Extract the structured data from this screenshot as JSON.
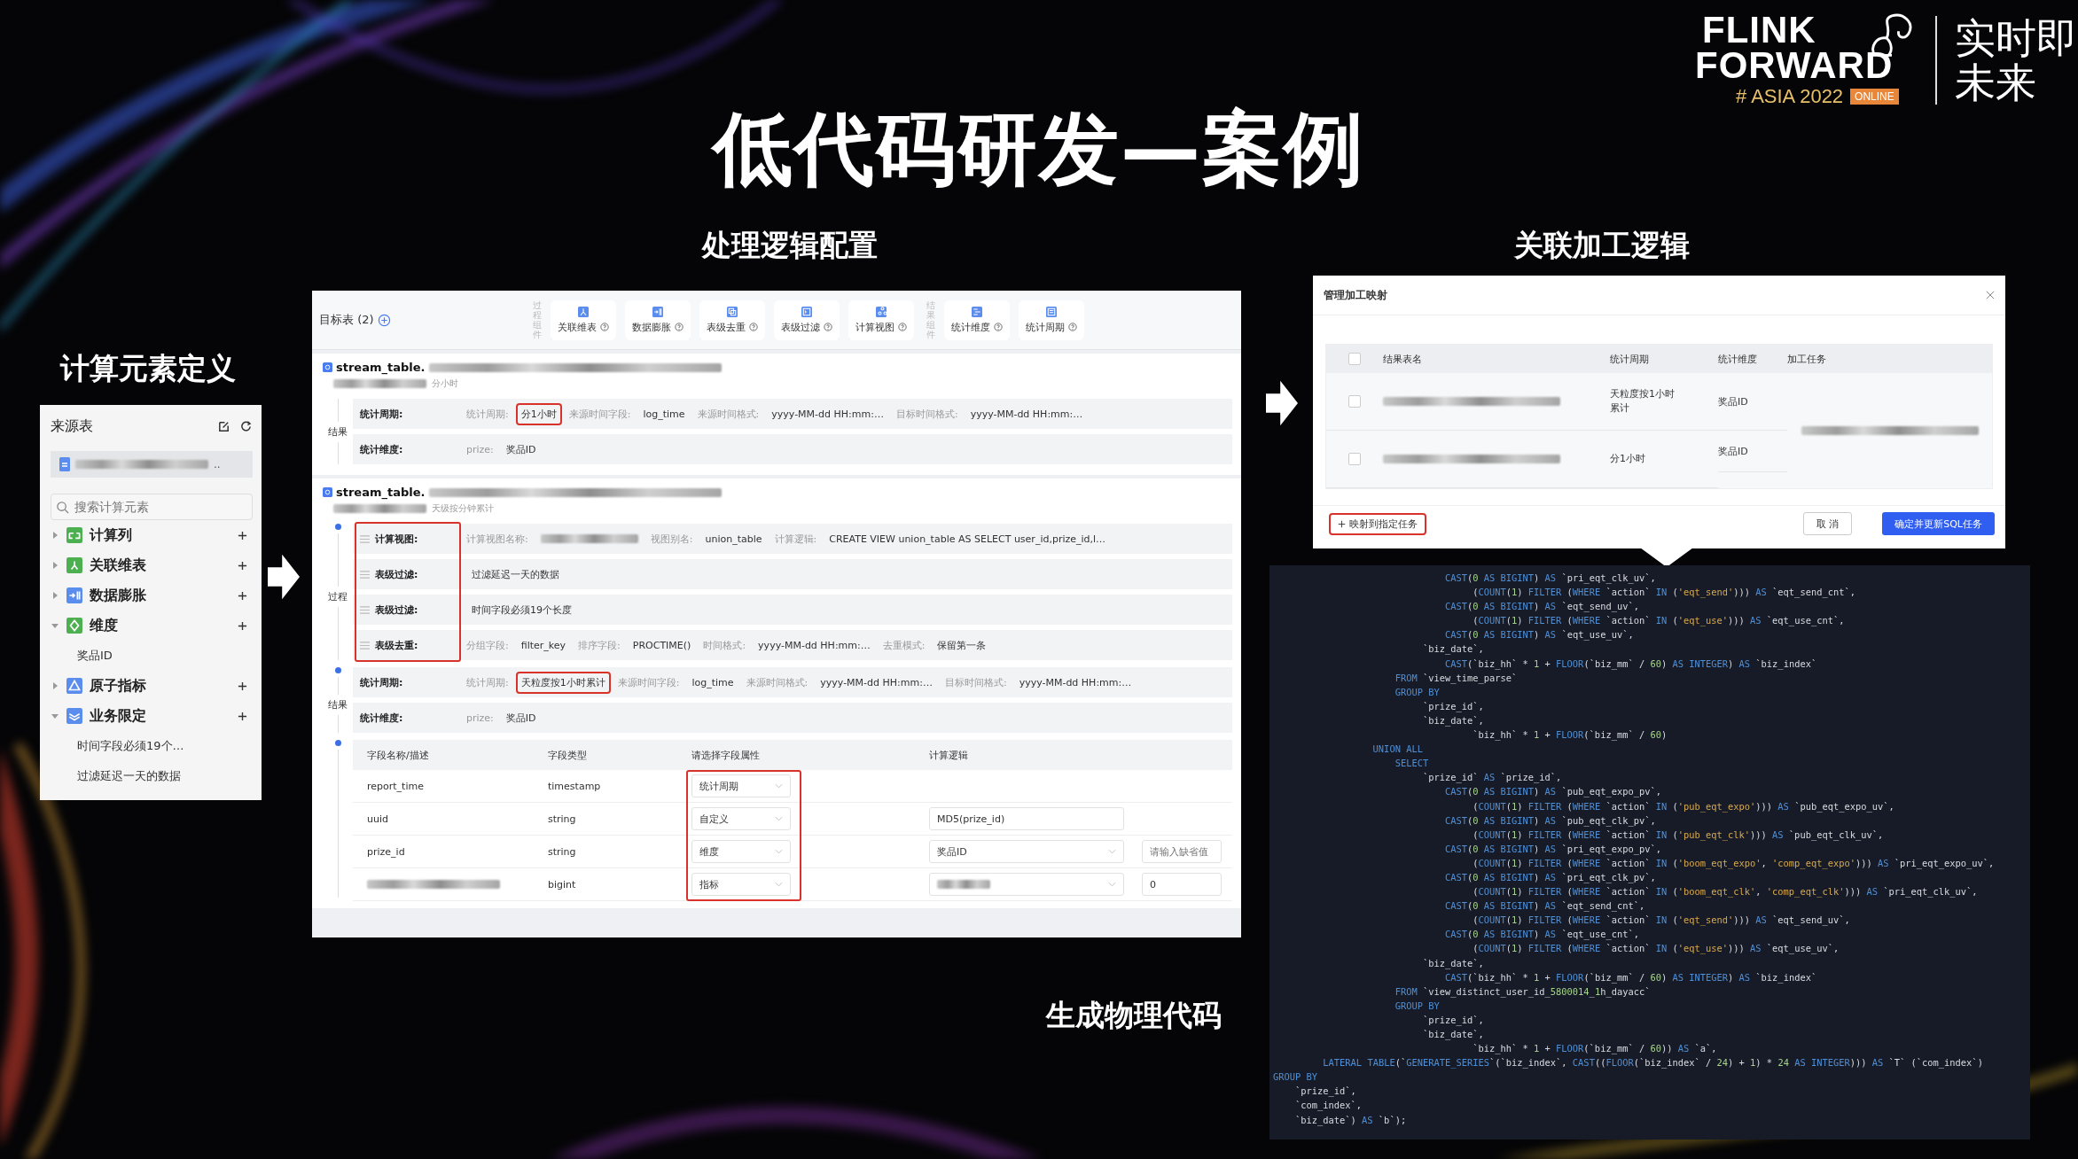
{
  "title": "低代码研发—案例",
  "logo": {
    "name_lines": [
      "FLINK",
      "FORWARD"
    ],
    "event": "# ASIA 2022",
    "badge": "ONLINE",
    "slogan_lines": [
      "实时即",
      "未来"
    ]
  },
  "element_panel": {
    "heading": "计算元素定义",
    "title": "来源表",
    "source": {
      "suffix": ".."
    },
    "search": {
      "placeholder": "搜索计算元素"
    },
    "tree": [
      {
        "label": "计算列",
        "kind": "calc",
        "color": "#4cb050",
        "expanded": false
      },
      {
        "label": "关联维表",
        "kind": "join",
        "color": "#4cb050",
        "expanded": false
      },
      {
        "label": "数据膨胀",
        "kind": "expand",
        "color": "#5b8def",
        "expanded": false
      },
      {
        "label": "维度",
        "kind": "dimension",
        "color": "#4cb050",
        "expanded": true,
        "children": [
          {
            "label": "奖品ID"
          }
        ]
      },
      {
        "label": "原子指标",
        "kind": "metric",
        "color": "#5b8def",
        "expanded": false
      },
      {
        "label": "业务限定",
        "kind": "filter",
        "color": "#5b8def",
        "expanded": true,
        "children": [
          {
            "label": "时间字段必须19个…"
          },
          {
            "label": "过滤延迟一天的数据"
          }
        ]
      }
    ]
  },
  "logic_panel": {
    "heading": "处理逻辑配置",
    "toolbar": {
      "target_label": "目标表 (2)",
      "groups": [
        {
          "label": "过程组件",
          "buttons": [
            {
              "label": "关联维表",
              "kind": "join"
            },
            {
              "label": "数据膨胀",
              "kind": "expand"
            },
            {
              "label": "表级去重",
              "kind": "dedupe"
            },
            {
              "label": "表级过滤",
              "kind": "filter"
            },
            {
              "label": "计算视图",
              "kind": "view"
            }
          ]
        },
        {
          "label": "结果组件",
          "buttons": [
            {
              "label": "统计维度",
              "kind": "dimension"
            },
            {
              "label": "统计周期",
              "kind": "period"
            }
          ]
        }
      ]
    },
    "cards": [
      {
        "name_prefix": "stream_table.",
        "subtitle": "分小时",
        "timeline": false,
        "stages": [
          {
            "label": "结果",
            "kind": "result",
            "labels_highlighted": false,
            "rows": [
              {
                "label": "统计周期:",
                "fields": [
                  {
                    "key": "统计周期:",
                    "value": "分1小时",
                    "highlighted": true
                  },
                  {
                    "key": "来源时间字段:",
                    "value": "log_time",
                    "highlighted": false
                  },
                  {
                    "key": "来源时间格式:",
                    "value": "yyyy-MM-dd HH:mm:…",
                    "highlighted": false
                  },
                  {
                    "key": "目标时间格式:",
                    "value": "yyyy-MM-dd HH:mm:…",
                    "highlighted": false
                  }
                ]
              },
              {
                "label": "统计维度:",
                "fields": [
                  {
                    "key": "prize:",
                    "value": "奖品ID",
                    "highlighted": false
                  }
                ]
              }
            ]
          }
        ]
      },
      {
        "name_prefix": "stream_table.",
        "subtitle": "天级按分钟累计",
        "timeline": true,
        "stages": [
          {
            "label": "过程",
            "kind": "process",
            "labels_highlighted": true,
            "rows": [
              {
                "label": "计算视图:",
                "fields": [
                  {
                    "key": "计算视图名称:",
                    "redacted": true,
                    "highlighted": false
                  },
                  {
                    "key": "视图别名:",
                    "value": "union_table",
                    "highlighted": false
                  },
                  {
                    "key": "计算逻辑:",
                    "value": "CREATE VIEW union_table AS SELECT user_id,prize_id,l…",
                    "highlighted": false
                  }
                ]
              },
              {
                "label": "表级过滤:",
                "fields": [
                  {
                    "value": "过滤延迟一天的数据",
                    "highlighted": false
                  }
                ]
              },
              {
                "label": "表级过滤:",
                "fields": [
                  {
                    "value": "时间字段必须19个长度",
                    "highlighted": false
                  }
                ]
              },
              {
                "label": "表级去重:",
                "fields": [
                  {
                    "key": "分组字段:",
                    "value": "filter_key",
                    "highlighted": false
                  },
                  {
                    "key": "排序字段:",
                    "value": "PROCTIME()",
                    "highlighted": false
                  },
                  {
                    "key": "时间格式:",
                    "value": "yyyy-MM-dd HH:mm:…",
                    "highlighted": false
                  },
                  {
                    "key": "去重模式:",
                    "value": "保留第一条",
                    "highlighted": false
                  }
                ]
              }
            ]
          },
          {
            "label": "结果",
            "kind": "result",
            "labels_highlighted": false,
            "rows": [
              {
                "label": "统计周期:",
                "fields": [
                  {
                    "key": "统计周期:",
                    "value": "天粒度按1小时累计",
                    "highlighted": true
                  },
                  {
                    "key": "来源时间字段:",
                    "value": "log_time",
                    "highlighted": false
                  },
                  {
                    "key": "来源时间格式:",
                    "value": "yyyy-MM-dd HH:mm:…",
                    "highlighted": false
                  },
                  {
                    "key": "目标时间格式:",
                    "value": "yyyy-MM-dd HH:mm:…",
                    "highlighted": false
                  }
                ]
              },
              {
                "label": "统计维度:",
                "fields": [
                  {
                    "key": "prize:",
                    "value": "奖品ID",
                    "highlighted": false
                  }
                ]
              }
            ]
          }
        ],
        "table": {
          "columns": [
            "字段名称/描述",
            "字段类型",
            "请选择字段属性",
            "计算逻辑"
          ],
          "attribute_highlighted": true,
          "rows": [
            {
              "name": "report_time",
              "type": "timestamp",
              "attribute": "统计周期"
            },
            {
              "name": "uuid",
              "type": "string",
              "attribute": "自定义",
              "logic": "MD5(prize_id)"
            },
            {
              "name": "prize_id",
              "type": "string",
              "attribute": "维度",
              "logic_select": "奖品ID",
              "default_placeholder": "请输入缺省值"
            },
            {
              "name_redacted": true,
              "type": "bigint",
              "attribute": "指标",
              "logic_select_redacted": true,
              "default_value": "0"
            }
          ]
        }
      }
    ]
  },
  "mapping_panel": {
    "heading": "关联加工逻辑",
    "dialog": {
      "title": "管理加工映射",
      "columns": [
        "结果表名",
        "统计周期",
        "统计维度",
        "加工任务"
      ],
      "header_checked": false,
      "rows": [
        {
          "checked": false,
          "period": "天粒度按1小时累计",
          "dimension": "奖品ID"
        },
        {
          "checked": false,
          "period": "分1小时",
          "dimension": "奖品ID"
        }
      ],
      "add_button": {
        "label": "映射到指定任务",
        "highlighted": true
      },
      "cancel": "取 消",
      "confirm": "确定并更新SQL任务"
    }
  },
  "code_panel": {
    "heading": "生成物理代码",
    "lines": [
      "                               CAST(0 AS BIGINT) AS `pri_eqt_clk_uv`,",
      "                                    (COUNT(1) FILTER (WHERE `action` IN ('eqt_send'))) AS `eqt_send_cnt`,",
      "                               CAST(0 AS BIGINT) AS `eqt_send_uv`,",
      "                                    (COUNT(1) FILTER (WHERE `action` IN ('eqt_use'))) AS `eqt_use_cnt`,",
      "                               CAST(0 AS BIGINT) AS `eqt_use_uv`,",
      "                           `biz_date`,",
      "                               CAST(`biz_hh` * 1 + FLOOR(`biz_mm` / 60) AS INTEGER) AS `biz_index`",
      "                      FROM `view_time_parse`",
      "                      GROUP BY",
      "                           `prize_id`,",
      "                           `biz_date`,",
      "                                    `biz_hh` * 1 + FLOOR(`biz_mm` / 60)",
      "                  UNION ALL",
      "                      SELECT",
      "                           `prize_id` AS `prize_id`,",
      "                               CAST(0 AS BIGINT) AS `pub_eqt_expo_pv`,",
      "                                    (COUNT(1) FILTER (WHERE `action` IN ('pub_eqt_expo'))) AS `pub_eqt_expo_uv`,",
      "                               CAST(0 AS BIGINT) AS `pub_eqt_clk_pv`,",
      "                                    (COUNT(1) FILTER (WHERE `action` IN ('pub_eqt_clk'))) AS `pub_eqt_clk_uv`,",
      "                               CAST(0 AS BIGINT) AS `pri_eqt_expo_pv`,",
      "                                    (COUNT(1) FILTER (WHERE `action` IN ('boom_eqt_expo', 'comp_eqt_expo'))) AS `pri_eqt_expo_uv`,",
      "                               CAST(0 AS BIGINT) AS `pri_eqt_clk_pv`,",
      "                                    (COUNT(1) FILTER (WHERE `action` IN ('boom_eqt_clk', 'comp_eqt_clk'))) AS `pri_eqt_clk_uv`,",
      "                               CAST(0 AS BIGINT) AS `eqt_send_cnt`,",
      "                                    (COUNT(1) FILTER (WHERE `action` IN ('eqt_send'))) AS `eqt_send_uv`,",
      "                               CAST(0 AS BIGINT) AS `eqt_use_cnt`,",
      "                                    (COUNT(1) FILTER (WHERE `action` IN ('eqt_use'))) AS `eqt_use_uv`,",
      "                           `biz_date`,",
      "                               CAST(`biz_hh` * 1 + FLOOR(`biz_mm` / 60) AS INTEGER) AS `biz_index`",
      "                      FROM `view_distinct_user_id_5800014_1h_dayacc`",
      "                      GROUP BY",
      "                           `prize_id`,",
      "                           `biz_date`,",
      "                                    `biz_hh` * 1 + FLOOR(`biz_mm` / 60)) AS `a`,",
      "         LATERAL TABLE(`GENERATE_SERIES`(`biz_index`, CAST((FLOOR(`biz_index` / 24) + 1) * 24 AS INTEGER))) AS `T` (`com_index`)",
      "GROUP BY",
      "    `prize_id`,",
      "    `com_index`,",
      "    `biz_date`) AS `b`);"
    ]
  }
}
